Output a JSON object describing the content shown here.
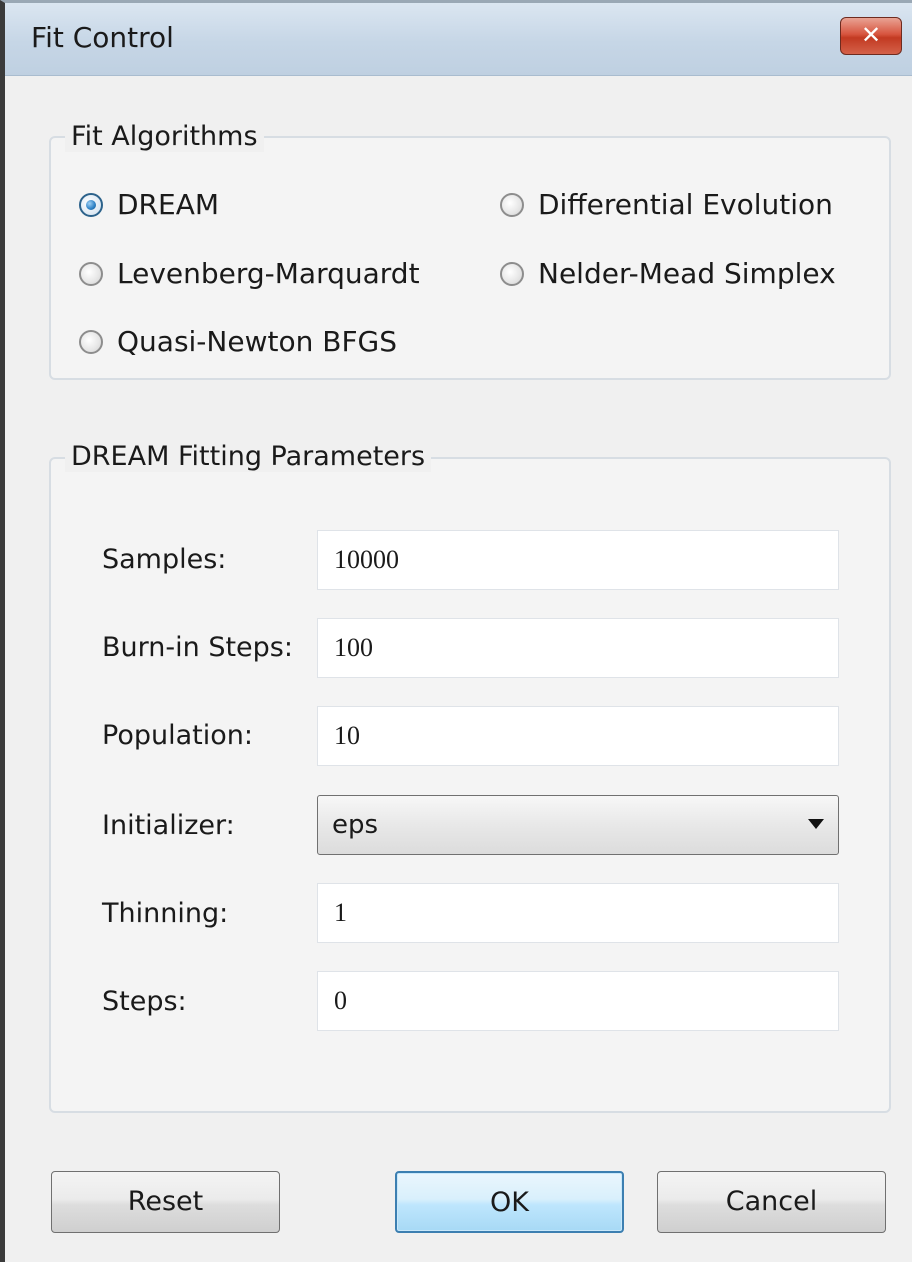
{
  "window": {
    "title": "Fit Control",
    "close_glyph": "✕"
  },
  "algorithms": {
    "legend": "Fit Algorithms",
    "options": [
      {
        "label": "DREAM",
        "checked": true
      },
      {
        "label": "Differential Evolution",
        "checked": false
      },
      {
        "label": "Levenberg-Marquardt",
        "checked": false
      },
      {
        "label": "Nelder-Mead Simplex",
        "checked": false
      },
      {
        "label": "Quasi-Newton BFGS",
        "checked": false
      }
    ]
  },
  "params": {
    "legend": "DREAM Fitting Parameters",
    "samples": {
      "label": "Samples:",
      "value": "10000"
    },
    "burn_in": {
      "label": "Burn-in Steps:",
      "value": "100"
    },
    "population": {
      "label": "Population:",
      "value": "10"
    },
    "initializer": {
      "label": "Initializer:",
      "value": "eps"
    },
    "thinning": {
      "label": "Thinning:",
      "value": "1"
    },
    "steps": {
      "label": "Steps:",
      "value": "0"
    }
  },
  "buttons": {
    "reset": "Reset",
    "ok": "OK",
    "cancel": "Cancel"
  },
  "icons": {
    "close": "close-icon",
    "dropdown": "chevron-down-icon"
  },
  "colors": {
    "title_bar": "#c6d6e6",
    "close_button": "#c23a22",
    "radio_selected": "#2a7fc4",
    "default_button_border": "#3c7fb1"
  }
}
